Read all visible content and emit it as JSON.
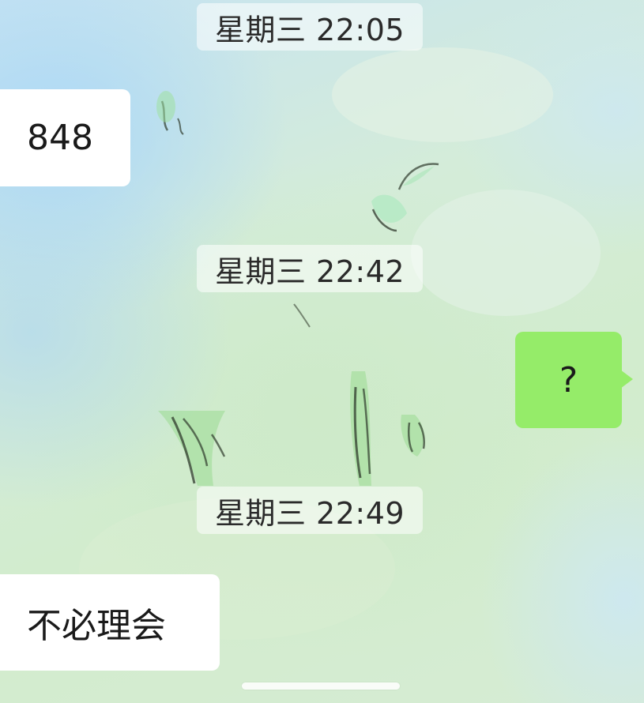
{
  "chat": {
    "timestamps": {
      "t1": "星期三 22:05",
      "t2": "星期三 22:42",
      "t3": "星期三 22:49"
    },
    "messages": {
      "incoming_1": "848",
      "outgoing_1": "?",
      "incoming_2": "不必理会"
    }
  },
  "colors": {
    "incoming_bubble": "#ffffff",
    "outgoing_bubble": "#95ec69",
    "timestamp_bg": "rgba(255,255,255,0.55)"
  }
}
